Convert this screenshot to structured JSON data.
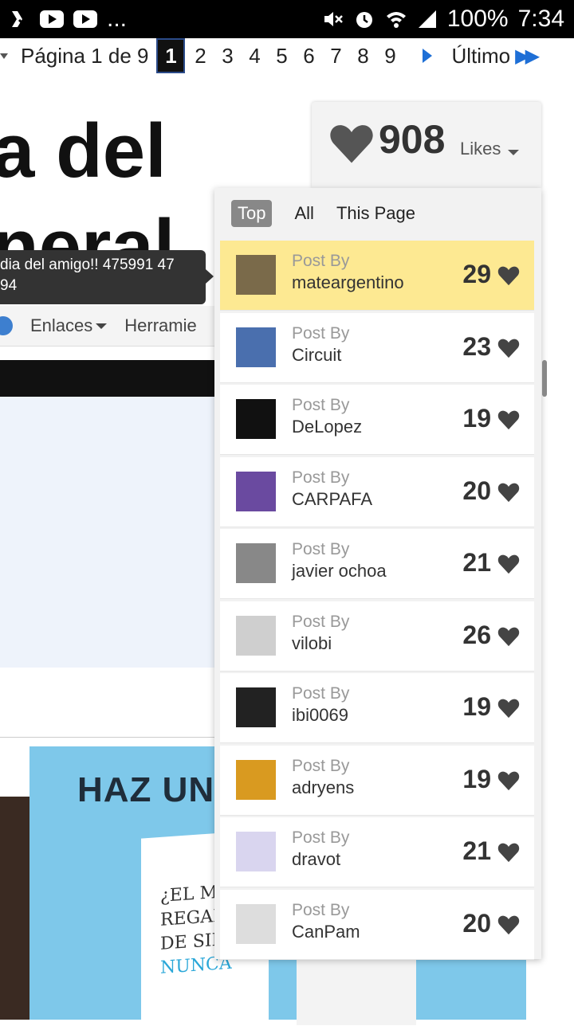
{
  "status_bar": {
    "more": "...",
    "battery": "100%",
    "time": "7:34"
  },
  "pagination": {
    "label": "Página 1 de 9",
    "pages": [
      "1",
      "2",
      "3",
      "4",
      "5",
      "6",
      "7",
      "8",
      "9"
    ],
    "current": "1",
    "last_label": "Último"
  },
  "page": {
    "title_line1": "a del",
    "title_line2": "neral",
    "tooltip": "dia del amigo!! 475991 47\n94",
    "nav": {
      "links": "Enlaces",
      "tools": "Herramie"
    },
    "ad": {
      "headline": "HAZ UN",
      "card_line1": "¿EL MIS",
      "card_line2": "REGAL",
      "card_line3": "DE SIEMP",
      "card_line4": "NUNCA"
    }
  },
  "likes": {
    "count": "908",
    "label": "Likes",
    "tabs": [
      "Top",
      "All",
      "This Page"
    ],
    "active_tab": "Top",
    "post_by_label": "Post By",
    "items": [
      {
        "author": "mateargentino",
        "count": "29",
        "highlight": true,
        "avatar_color": "#7a6a4a"
      },
      {
        "author": "Circuit",
        "count": "23",
        "avatar_color": "#4a6fae"
      },
      {
        "author": "DeLopez",
        "count": "19",
        "avatar_color": "#111111"
      },
      {
        "author": "CARPAFA",
        "count": "20",
        "avatar_color": "#6a4aa0"
      },
      {
        "author": "javier ochoa",
        "count": "21",
        "avatar_color": "#888888"
      },
      {
        "author": "vilobi",
        "count": "26",
        "avatar_color": "#cfcfcf"
      },
      {
        "author": "ibi0069",
        "count": "19",
        "avatar_color": "#222222"
      },
      {
        "author": "adryens",
        "count": "19",
        "avatar_color": "#d99a20"
      },
      {
        "author": "dravot",
        "count": "21",
        "avatar_color": "#d9d5ef"
      },
      {
        "author": "CanPam",
        "count": "20",
        "avatar_color": "#dddddd"
      }
    ]
  }
}
